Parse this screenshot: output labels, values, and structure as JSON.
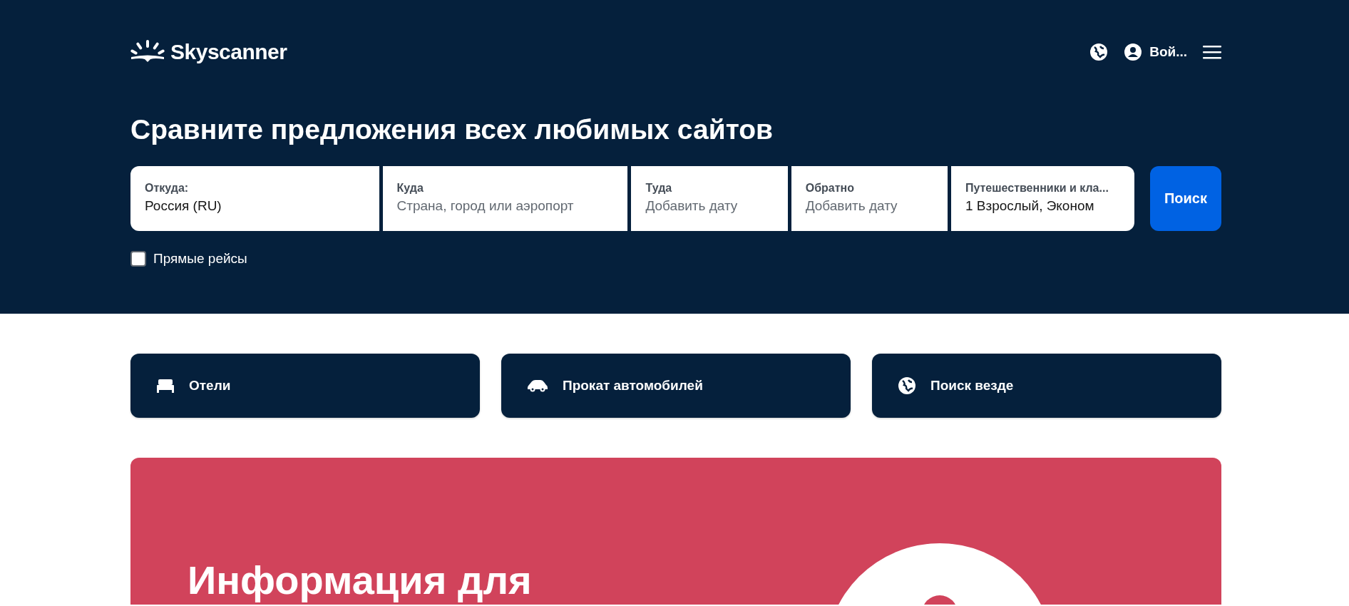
{
  "header": {
    "logo": "Skyscanner",
    "login": "Вой...",
    "title": "Сравните предложения всех любимых сайтов"
  },
  "search": {
    "fields": [
      {
        "label": "Откуда:",
        "value": "Россия (RU)"
      },
      {
        "label": "Куда",
        "placeholder": "Страна, город или аэропорт"
      },
      {
        "label": "Туда",
        "placeholder": "Добавить дату"
      },
      {
        "label": "Обратно",
        "placeholder": "Добавить дату"
      },
      {
        "label": "Путешественники и кла...",
        "value": "1 Взрослый, Эконом"
      }
    ],
    "button": "Поиск",
    "direct": {
      "label": "Прямые рейсы",
      "checked": false
    }
  },
  "services": [
    {
      "kind": "hotel",
      "label": "Отели"
    },
    {
      "kind": "car",
      "label": "Прокат автомобилей"
    },
    {
      "kind": "globe",
      "label": "Поиск везде"
    }
  ],
  "banner": {
    "heading": "Информация для"
  }
}
